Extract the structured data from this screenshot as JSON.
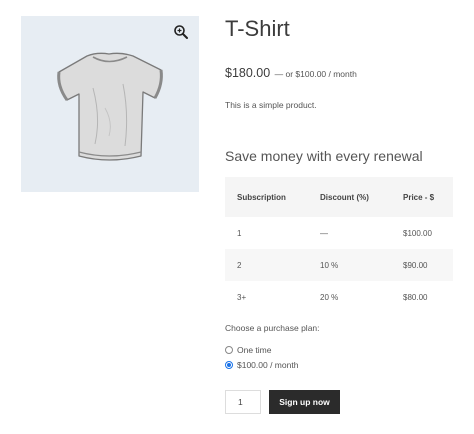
{
  "product": {
    "title": "T-Shirt",
    "price": "$180.00",
    "price_suffix": "— or $100.00 / month",
    "description": "This is a simple product.",
    "image_icon": "t-shirt-illustration",
    "zoom_icon": "magnifier-plus-icon"
  },
  "subscription": {
    "heading": "Save money with every renewal",
    "table": {
      "headers": [
        "Subscription",
        "Discount (%)",
        "Price - $"
      ],
      "rows": [
        [
          "1",
          "—",
          "$100.00"
        ],
        [
          "2",
          "10 %",
          "$90.00"
        ],
        [
          "3+",
          "20 %",
          "$80.00"
        ]
      ]
    },
    "plan_label": "Choose a purchase plan:",
    "plans": [
      {
        "label": "One time",
        "selected": false
      },
      {
        "label": "$100.00 / month",
        "selected": true
      }
    ]
  },
  "cart": {
    "quantity": "1",
    "button_label": "Sign up now"
  },
  "colors": {
    "gallery_bg": "#e7edf3",
    "button_bg": "#2b2b2b",
    "radio_accent": "#1a73e8"
  }
}
